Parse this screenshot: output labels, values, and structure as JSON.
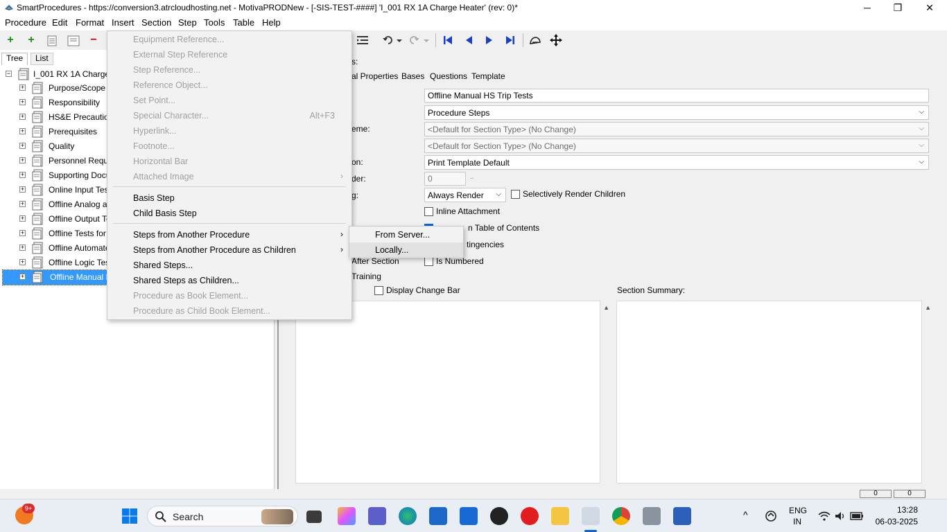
{
  "titlebar": {
    "title": "SmartProcedures - https://conversion3.atrcloudhosting.net - MotivaPRODNew - [-SIS-TEST-####] 'I_001 RX 1A Charge Heater' (rev: 0)*",
    "minimize": "─",
    "maximize": "❐",
    "close": "✕"
  },
  "menubar": [
    "Procedure",
    "Edit",
    "Format",
    "Insert",
    "Section",
    "Step",
    "Tools",
    "Table",
    "Help"
  ],
  "toolbar": {
    "add": "+",
    "add_child": "+",
    "remove": "−"
  },
  "left": {
    "tabs": [
      "Tree",
      "List"
    ],
    "root": "I_001 RX 1A Charge I",
    "items": [
      "Purpose/Scope",
      "Responsibility",
      "HS&E Precaution",
      "Prerequisites",
      "Quality",
      "Personnel Requir",
      "Supporting Docu",
      "Online Input Tes",
      "Offline Analog ar",
      "Offline Output Te",
      "Offline Tests for",
      "Offline Automate",
      "Offline Logic Tes",
      "Offline Manual H"
    ]
  },
  "right": {
    "header_suffix": "s:",
    "tabs": [
      "al Properties",
      "Bases",
      "Questions",
      "Template"
    ],
    "title_value": "Offline Manual HS Trip Tests",
    "type_value": "Procedure Steps",
    "label_scheme": "eme:",
    "scheme_value": "<Default for Section Type> (No Change)",
    "scheme2_value": "<Default for Section Type> (No Change)",
    "label_template": "on:",
    "template_value": "Print Template Default",
    "label_order": "der:",
    "order_value": "0",
    "order_btn": "..",
    "label_rendering": "g:",
    "rendering_value": "Always Render",
    "selectively_render": "Selectively Render Children",
    "inline_attachment": "Inline Attachment",
    "in_toc": "n Table of Contents",
    "contingencies": "tingencies",
    "after_section": "After Section",
    "is_numbered": "Is Numbered",
    "training": "Training",
    "display_change_bar": "Display Change Bar",
    "section_summary": "Section Summary:"
  },
  "insert_menu": {
    "items": [
      {
        "label": "Equipment Reference...",
        "disabled": true
      },
      {
        "label": "External Step Reference",
        "disabled": true
      },
      {
        "label": "Step Reference...",
        "disabled": true
      },
      {
        "label": "Reference Object...",
        "disabled": true
      },
      {
        "label": "Set Point...",
        "disabled": true
      },
      {
        "label": "Special Character...",
        "shortcut": "Alt+F3",
        "disabled": true
      },
      {
        "label": "Hyperlink...",
        "disabled": true
      },
      {
        "label": "Footnote...",
        "disabled": true
      },
      {
        "label": "Horizontal Bar",
        "disabled": true
      },
      {
        "label": "Attached Image",
        "disabled": true
      },
      {
        "label": "Basis Step",
        "disabled": false
      },
      {
        "label": "Child Basis Step",
        "disabled": false
      },
      {
        "label": "Steps from Another Procedure",
        "disabled": false
      },
      {
        "label": "Steps from Another Procedure as Children",
        "disabled": false
      },
      {
        "label": "Shared Steps...",
        "disabled": false
      },
      {
        "label": "Shared Steps as Children...",
        "disabled": false
      },
      {
        "label": "Procedure as Book Element...",
        "disabled": true
      },
      {
        "label": "Procedure as Child Book Element...",
        "disabled": true
      }
    ]
  },
  "submenu": {
    "items": [
      "From Server...",
      "Locally..."
    ]
  },
  "statusbar": {
    "box1": "0",
    "box2": "0"
  },
  "taskbar": {
    "notification_badge": "9+",
    "search_label": "Search",
    "language": "ENG",
    "region": "IN",
    "time": "13:28",
    "date": "06-03-2025"
  },
  "colors": {
    "selection": "#3399ff",
    "checkbox_checked": "#0a64d6",
    "toolbar_nav": "#1a3fc4"
  }
}
